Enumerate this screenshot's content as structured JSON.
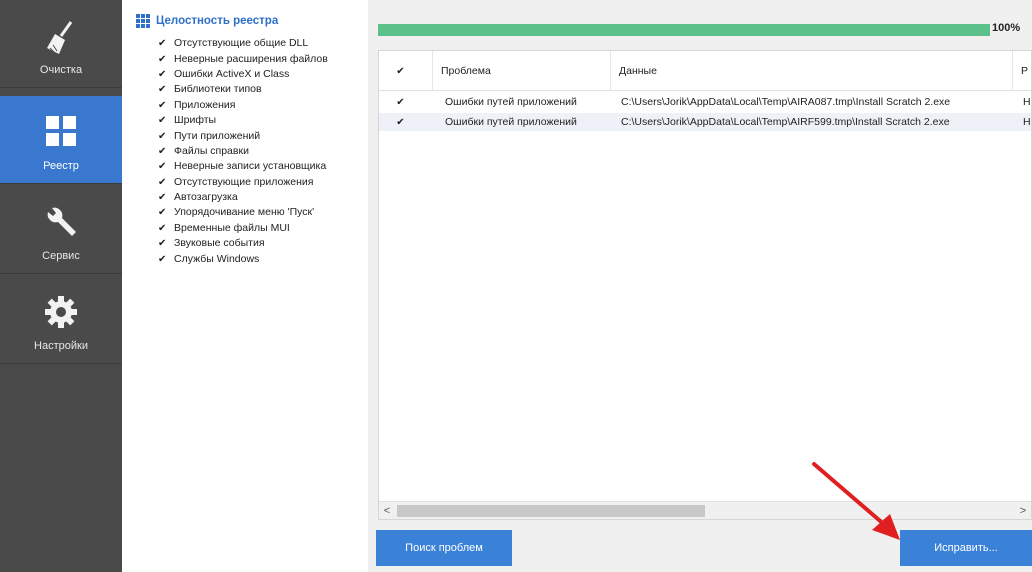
{
  "nav": {
    "items": [
      {
        "label": "Очистка",
        "icon": "broom-icon",
        "active": false
      },
      {
        "label": "Реестр",
        "icon": "registry-grid-icon",
        "active": true
      },
      {
        "label": "Сервис",
        "icon": "wrench-icon",
        "active": false
      },
      {
        "label": "Настройки",
        "icon": "gear-icon",
        "active": false
      }
    ]
  },
  "tree": {
    "title": "Целостность реестра",
    "items": [
      "Отсутствующие общие DLL",
      "Неверные расширения файлов",
      "Ошибки ActiveX и Class",
      "Библиотеки типов",
      "Приложения",
      "Шрифты",
      "Пути приложений",
      "Файлы справки",
      "Неверные записи установщика",
      "Отсутствующие приложения",
      "Автозагрузка",
      "Упорядочивание меню 'Пуск'",
      "Временные файлы MUI",
      "Звуковые события",
      "Службы Windows"
    ]
  },
  "progress": {
    "value": 1.0,
    "label": "100%"
  },
  "table": {
    "columns": [
      "",
      "Проблема",
      "Данные",
      "Р"
    ],
    "rows": [
      {
        "checked": true,
        "problem": "Ошибки путей приложений",
        "data": "C:\\Users\\Jorik\\AppData\\Local\\Temp\\AIRA087.tmp\\Install Scratch 2.exe",
        "extra": "H"
      },
      {
        "checked": true,
        "problem": "Ошибки путей приложений",
        "data": "C:\\Users\\Jorik\\AppData\\Local\\Temp\\AIRF599.tmp\\Install Scratch 2.exe",
        "extra": "H"
      }
    ]
  },
  "buttons": {
    "scan": "Поиск проблем",
    "fix": "Исправить..."
  },
  "colors": {
    "accent": "#3a82d8",
    "progress": "#5cc08a",
    "nav_bg": "#4a4a4a",
    "annotation_arrow": "#e02020"
  }
}
